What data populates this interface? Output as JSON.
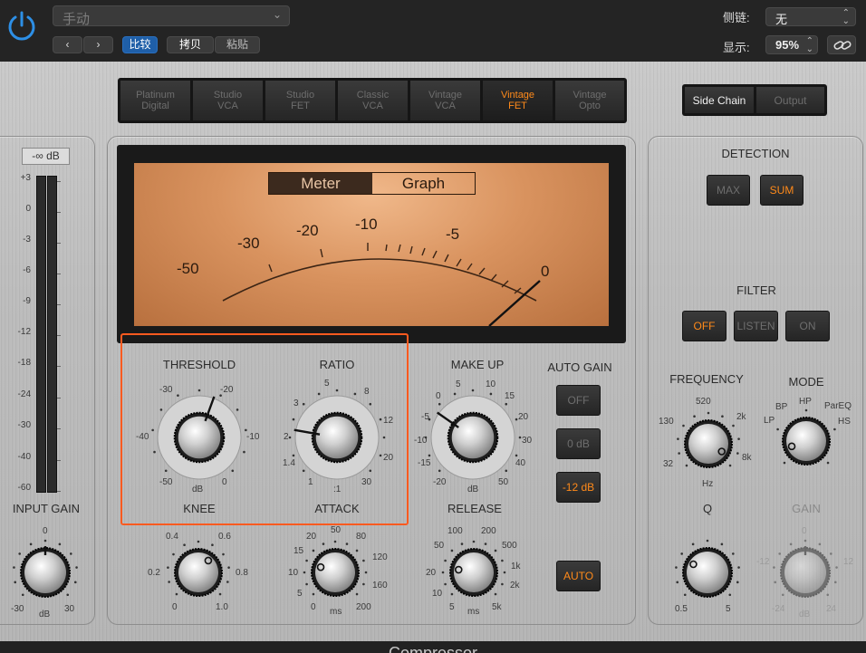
{
  "header": {
    "preset": "手动",
    "compare": "比较",
    "copy": "拷贝",
    "paste": "粘贴",
    "sidechain_label": "侧链:",
    "sidechain_value": "无",
    "display_label": "显示:",
    "zoom": "95%"
  },
  "models": [
    "Platinum\nDigital",
    "Studio\nVCA",
    "Studio\nFET",
    "Classic\nVCA",
    "Vintage\nVCA",
    "Vintage\nFET",
    "Vintage\nOpto"
  ],
  "active_model": "Vintage\nFET",
  "view_buttons": {
    "side_chain": "Side Chain",
    "output": "Output"
  },
  "input_meter": {
    "peak": "-∞ dB",
    "scale": [
      "+3",
      "0",
      "-3",
      "-6",
      "-9",
      "-12",
      "-18",
      "-24",
      "-30",
      "-40",
      "-60"
    ]
  },
  "meter_tabs": {
    "meter": "Meter",
    "graph": "Graph"
  },
  "vu_scale": [
    "-50",
    "-30",
    "-20",
    "-10",
    "-5",
    "0"
  ],
  "knobs": {
    "threshold": {
      "label": "THRESHOLD",
      "unit": "dB",
      "ticks": [
        "-30",
        "-20",
        "-40",
        "-10",
        "-50",
        "0"
      ]
    },
    "ratio": {
      "label": "RATIO",
      "unit": ":1",
      "ticks": [
        "5",
        "8",
        "3",
        "12",
        "2",
        "20",
        "1.4",
        "30",
        "1"
      ]
    },
    "makeup": {
      "label": "MAKE UP",
      "unit": "dB",
      "ticks": [
        "5",
        "10",
        "0",
        "15",
        "-5",
        "20",
        "-10",
        "30",
        "-15",
        "40",
        "-20",
        "50"
      ]
    },
    "knee": {
      "label": "KNEE",
      "ticks": [
        "0.4",
        "0.6",
        "0.2",
        "0.8",
        "0",
        "1.0"
      ]
    },
    "attack": {
      "label": "ATTACK",
      "unit": "ms",
      "ticks": [
        "50",
        "20",
        "80",
        "15",
        "120",
        "10",
        "160",
        "5",
        "200",
        "0"
      ]
    },
    "release": {
      "label": "RELEASE",
      "unit": "ms",
      "ticks": [
        "100",
        "200",
        "50",
        "500",
        "20",
        "1k",
        "10",
        "2k",
        "5",
        "5k"
      ]
    },
    "input_gain": {
      "label": "INPUT GAIN",
      "unit": "dB",
      "ticks": [
        "0",
        "-30",
        "30"
      ]
    },
    "frequency": {
      "label": "FREQUENCY",
      "unit": "Hz",
      "ticks": [
        "520",
        "130",
        "2k",
        "32",
        "8k"
      ]
    },
    "mode": {
      "label": "MODE",
      "ticks": [
        "HP",
        "BP",
        "ParEQ",
        "LP",
        "HS"
      ]
    },
    "q": {
      "label": "Q",
      "ticks": [
        "0.5",
        "5"
      ]
    },
    "gain": {
      "label": "GAIN",
      "unit": "dB",
      "ticks": [
        "0",
        "-12",
        "12",
        "-24",
        "24"
      ]
    }
  },
  "auto_gain": {
    "label": "AUTO GAIN",
    "off": "OFF",
    "zero": "0 dB",
    "minus12": "-12 dB",
    "selected": "-12 dB"
  },
  "auto_button": "AUTO",
  "detection": {
    "label": "DETECTION",
    "max": "MAX",
    "sum": "SUM",
    "selected": "SUM"
  },
  "filter": {
    "label": "FILTER",
    "off": "OFF",
    "listen": "LISTEN",
    "on": "ON",
    "selected": "OFF"
  },
  "footer_title": "Compressor",
  "colors": {
    "accent": "#ff8a1a",
    "highlight": "#ff5a1f",
    "meter_face": "#d08a55"
  }
}
